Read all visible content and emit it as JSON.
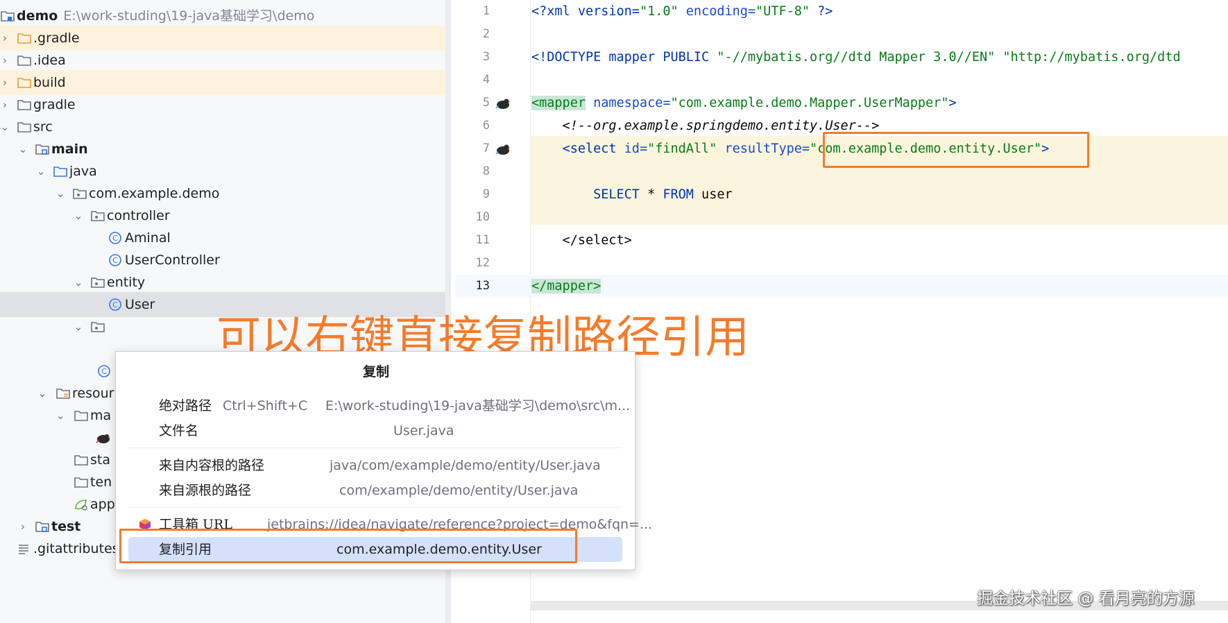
{
  "project_tree": {
    "root_name": "demo",
    "root_path": "E:\\work-studing\\19-java基础学习\\demo",
    "items": [
      {
        "label": ".gradle",
        "icon": "folder-icon"
      },
      {
        "label": ".idea",
        "icon": "folder-icon"
      },
      {
        "label": "build",
        "icon": "folder-icon"
      },
      {
        "label": "gradle",
        "icon": "folder-icon"
      },
      {
        "label": "src",
        "icon": "folder-icon"
      },
      {
        "label": "main",
        "icon": "source-root-folder-icon"
      },
      {
        "label": "java",
        "icon": "java-source-folder-icon"
      },
      {
        "label": "com.example.demo",
        "icon": "package-icon"
      },
      {
        "label": "controller",
        "icon": "package-icon"
      },
      {
        "label": "Aminal",
        "icon": "class-icon"
      },
      {
        "label": "UserController",
        "icon": "class-icon"
      },
      {
        "label": "entity",
        "icon": "package-icon"
      },
      {
        "label": "User",
        "icon": "class-icon"
      },
      {
        "label": "resour",
        "icon": "resources-folder-icon"
      },
      {
        "label": "ma",
        "icon": "folder-icon"
      },
      {
        "label": "sta",
        "icon": "folder-icon"
      },
      {
        "label": "ten",
        "icon": "folder-icon"
      },
      {
        "label": "app",
        "icon": "spring-config-icon"
      },
      {
        "label": "test",
        "icon": "test-folder-icon"
      },
      {
        "label": ".gitattributes",
        "icon": "text-file-icon"
      }
    ]
  },
  "editor": {
    "line_numbers": [
      "1",
      "2",
      "3",
      "4",
      "5",
      "6",
      "7",
      "8",
      "9",
      "10",
      "11",
      "12",
      "13"
    ],
    "lines": {
      "l1": {
        "a": "<?xml version=",
        "b": "\"1.0\"",
        "c": " encoding=",
        "d": "\"UTF-8\"",
        "e": " ?>"
      },
      "l3": {
        "a": "<!DOCTYPE mapper PUBLIC ",
        "b": "\"-//mybatis.org//dtd Mapper 3.0//EN\"",
        "c": " ",
        "d": "\"http://mybatis.org/dtd"
      },
      "l5": {
        "a": "<mapper",
        "b": " namespace=",
        "c": "\"com.example.demo.Mapper.UserMapper\"",
        "d": ">"
      },
      "l6": {
        "a": "    <!--org.example.springdemo.entity.User-->"
      },
      "l7": {
        "a": "    <select",
        "b": " id=",
        "c": "\"findAll\"",
        "d": " resultType=",
        "e": "\"com.example.demo.entity.User\"",
        "f": ">"
      },
      "l9": {
        "a": "        SELECT",
        "b": " * ",
        "c": "FROM",
        "d": " user"
      },
      "l11": {
        "a": "    </select>"
      },
      "l13": {
        "a": "</mapper",
        "b": ">"
      }
    }
  },
  "context_menu": {
    "title": "复制",
    "items": [
      {
        "label": "绝对路径",
        "shortcut": "Ctrl+Shift+C",
        "value": "E:\\work-studing\\19-java基础学习\\demo\\src\\m..."
      },
      {
        "label": "文件名",
        "value": "User.java"
      },
      {
        "label": "来自内容根的路径",
        "value": "java/com/example/demo/entity/User.java"
      },
      {
        "label": "来自源根的路径",
        "value": "com/example/demo/entity/User.java"
      },
      {
        "label": "工具箱 URL",
        "value": "jetbrains://idea/navigate/reference?project=demo&fqn=..."
      },
      {
        "label": "复制引用",
        "value": "com.example.demo.entity.User"
      }
    ]
  },
  "annotation": {
    "caption": "可以右键直接复制路径引用",
    "watermark": "掘金技术社区 @ 看月亮的方源"
  },
  "colors": {
    "accent_orange": "#f47b2b",
    "selection_blue": "#d5e1fb",
    "highlight_yellow": "#fcf5de"
  }
}
